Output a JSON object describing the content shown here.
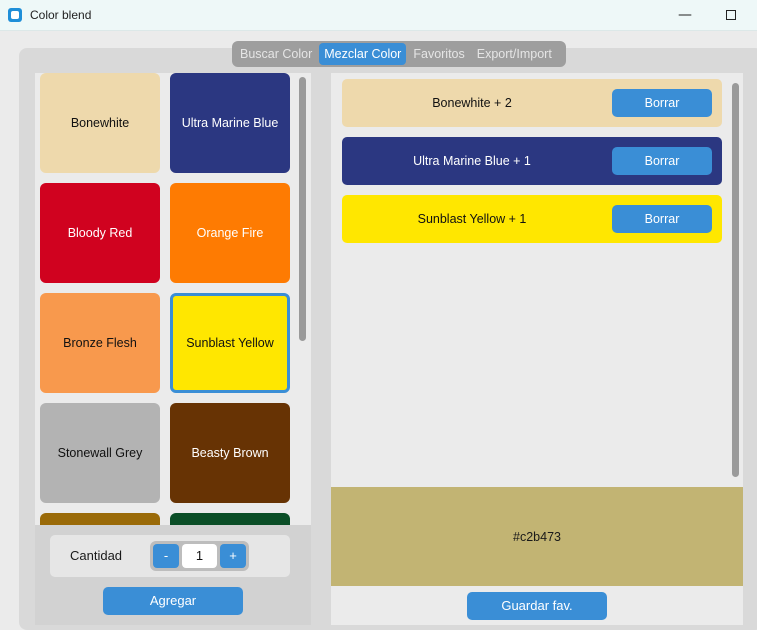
{
  "window": {
    "title": "Color blend",
    "minimize_glyph": "—"
  },
  "tabs": [
    {
      "label": "Buscar Color",
      "active": false
    },
    {
      "label": "Mezclar Color",
      "active": true
    },
    {
      "label": "Favoritos",
      "active": false
    },
    {
      "label": "Export/Import",
      "active": false
    }
  ],
  "colors": [
    {
      "name": "Bonewhite",
      "bg": "#eed9ac",
      "fg": "#111111"
    },
    {
      "name": "Ultra Marine Blue",
      "bg": "#2b3781",
      "fg": "#ffffff"
    },
    {
      "name": "Bloody Red",
      "bg": "#d0021f",
      "fg": "#ffffff"
    },
    {
      "name": "Orange Fire",
      "bg": "#fe7b02",
      "fg": "#ffffff"
    },
    {
      "name": "Bronze Flesh",
      "bg": "#f8994d",
      "fg": "#111111"
    },
    {
      "name": "Sunblast Yellow",
      "bg": "#ffe700",
      "fg": "#111111",
      "selected": true
    },
    {
      "name": "Stonewall Grey",
      "bg": "#b3b3b3",
      "fg": "#111111"
    },
    {
      "name": "Beasty Brown",
      "bg": "#673304",
      "fg": "#ffffff"
    },
    {
      "name": "",
      "bg": "#9a6a08",
      "fg": "#ffffff"
    },
    {
      "name": "",
      "bg": "#0b4e27",
      "fg": "#ffffff"
    }
  ],
  "quantity": {
    "label": "Cantidad",
    "minus": "-",
    "value": "1",
    "plus": "+"
  },
  "add_button": "Agregar",
  "mix": [
    {
      "label": "Bonewhite + 2",
      "bg": "#eed9ac",
      "fg": "#111111",
      "delete": "Borrar"
    },
    {
      "label": "Ultra Marine Blue + 1",
      "bg": "#2b3781",
      "fg": "#ffffff",
      "delete": "Borrar"
    },
    {
      "label": "Sunblast Yellow + 1",
      "bg": "#ffe700",
      "fg": "#111111",
      "delete": "Borrar"
    }
  ],
  "result": {
    "hex": "#c2b473"
  },
  "save_button": "Guardar fav.",
  "accent": "#3a8ed6"
}
